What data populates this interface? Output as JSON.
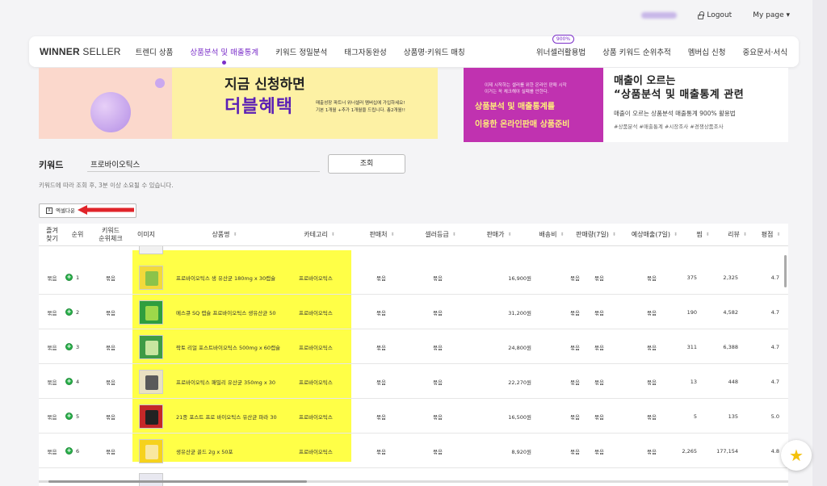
{
  "topbar": {
    "logout": "Logout",
    "mypage": "My page ▾"
  },
  "nav": {
    "logo_bold": "WINNER",
    "logo_light": " SELLER",
    "items": [
      "트렌디 상품",
      "상품분석 및 매출통계",
      "키워드 정밀분석",
      "태그자동완성",
      "상품명·키워드 매칭"
    ],
    "right_items": [
      "위너셀러활용법",
      "상품 키워드 순위추적",
      "멤버십 신청",
      "중요문서·서식"
    ],
    "badge": "900%"
  },
  "banner1": {
    "line1": "지금 신청하면",
    "line2": "더블혜택",
    "line3": "매출성장 파트너 위너셀러 멤버십에 가입하세요!",
    "line4": "기본 1개월 +추가 1개월을 드립니다. 총2개월!!"
  },
  "banner2": {
    "small1": "이제 시작하는 셀러를 위한 온라인 판매 시작",
    "small2": "이거는 꼭 체크해야 실패를 안한다.",
    "big1": "상품분석 및 매출통계를",
    "big2": "이용한 온라인판매 상품준비"
  },
  "banner3": {
    "title1": "매출이 오르는",
    "title2": "“상품분석 및 매출통계 관련",
    "sub": "매출이 오르는 상품분석 매출통계 900% 활용법",
    "hashtags": "#상품분석 #매출통계 #시장조사 #경쟁상품조사"
  },
  "search": {
    "label": "키워드",
    "value": "프로바이오틱스",
    "button": "조회",
    "hint": "키워드에 따라 조회 후, 3분 이상 소요될 수 있습니다."
  },
  "excel": {
    "label": "엑셀다운"
  },
  "table": {
    "headers": {
      "fav": "즐겨\n찾기",
      "rank": "순위",
      "check": "키워드\n순위체크",
      "image": "이미지",
      "name": "상품명",
      "category": "카테고리",
      "seller": "판매처",
      "grade": "셀러등급",
      "price": "판매가",
      "shipping": "배송비",
      "sales7": "판매량(7일)",
      "revenue7": "예상매출(7일)",
      "likes": "찜",
      "reviews": "리뷰",
      "rating": "평점"
    },
    "rows": [
      {
        "fav": "묶음",
        "rank": "1",
        "check": "묶음",
        "name": "프로바이오틱스 생 유산균 180mg x 30캡슐",
        "category": "프로바이오틱스",
        "seller": "묶음",
        "grade": "묶음",
        "price": "16,900원",
        "shipping": "묶음",
        "sales7": "묶음",
        "revenue7": "묶음",
        "likes": "375",
        "reviews": "2,325",
        "rating": "4.7"
      },
      {
        "fav": "묶음",
        "rank": "2",
        "check": "묶음",
        "name": "메스큐 SQ 캡슐 프로바이오틱스 생유산균 50",
        "category": "프로바이오틱스",
        "seller": "묶음",
        "grade": "묶음",
        "price": "31,200원",
        "shipping": "묶음",
        "sales7": "묶음",
        "revenue7": "묶음",
        "likes": "190",
        "reviews": "4,582",
        "rating": "4.7"
      },
      {
        "fav": "묶음",
        "rank": "3",
        "check": "묶음",
        "name": "락토 리얼 포스트바이오틱스 500mg x 60캡슐",
        "category": "프로바이오틱스",
        "seller": "묶음",
        "grade": "묶음",
        "price": "24,800원",
        "shipping": "묶음",
        "sales7": "묶음",
        "revenue7": "묶음",
        "likes": "311",
        "reviews": "6,388",
        "rating": "4.7"
      },
      {
        "fav": "묶음",
        "rank": "4",
        "check": "묶음",
        "name": "프로바이오틱스 패밀리 유산균 350mg x 30",
        "category": "프로바이오틱스",
        "seller": "묶음",
        "grade": "묶음",
        "price": "22,270원",
        "shipping": "묶음",
        "sales7": "묶음",
        "revenue7": "묶음",
        "likes": "13",
        "reviews": "448",
        "rating": "4.7"
      },
      {
        "fav": "묶음",
        "rank": "5",
        "check": "묶음",
        "name": "21종 포스트 프로 바이오틱스 유산균 파라 30",
        "category": "프로바이오틱스",
        "seller": "묶음",
        "grade": "묶음",
        "price": "16,500원",
        "shipping": "묶음",
        "sales7": "묶음",
        "revenue7": "묶음",
        "likes": "5",
        "reviews": "135",
        "rating": "5.0"
      },
      {
        "fav": "묶음",
        "rank": "6",
        "check": "묶음",
        "name": "생유산균 골드 2g x 50포",
        "category": "프로바이오틱스",
        "seller": "묶음",
        "grade": "묶음",
        "price": "8,920원",
        "shipping": "묶음",
        "sales7": "묶음",
        "revenue7": "묶음",
        "likes": "2,265",
        "reviews": "177,154",
        "rating": "4.8"
      }
    ]
  },
  "colors": {
    "accent": "#7b2fc9",
    "highlight": "#ffff00",
    "arrow": "#e0242a",
    "plus": "#2bb24c"
  }
}
